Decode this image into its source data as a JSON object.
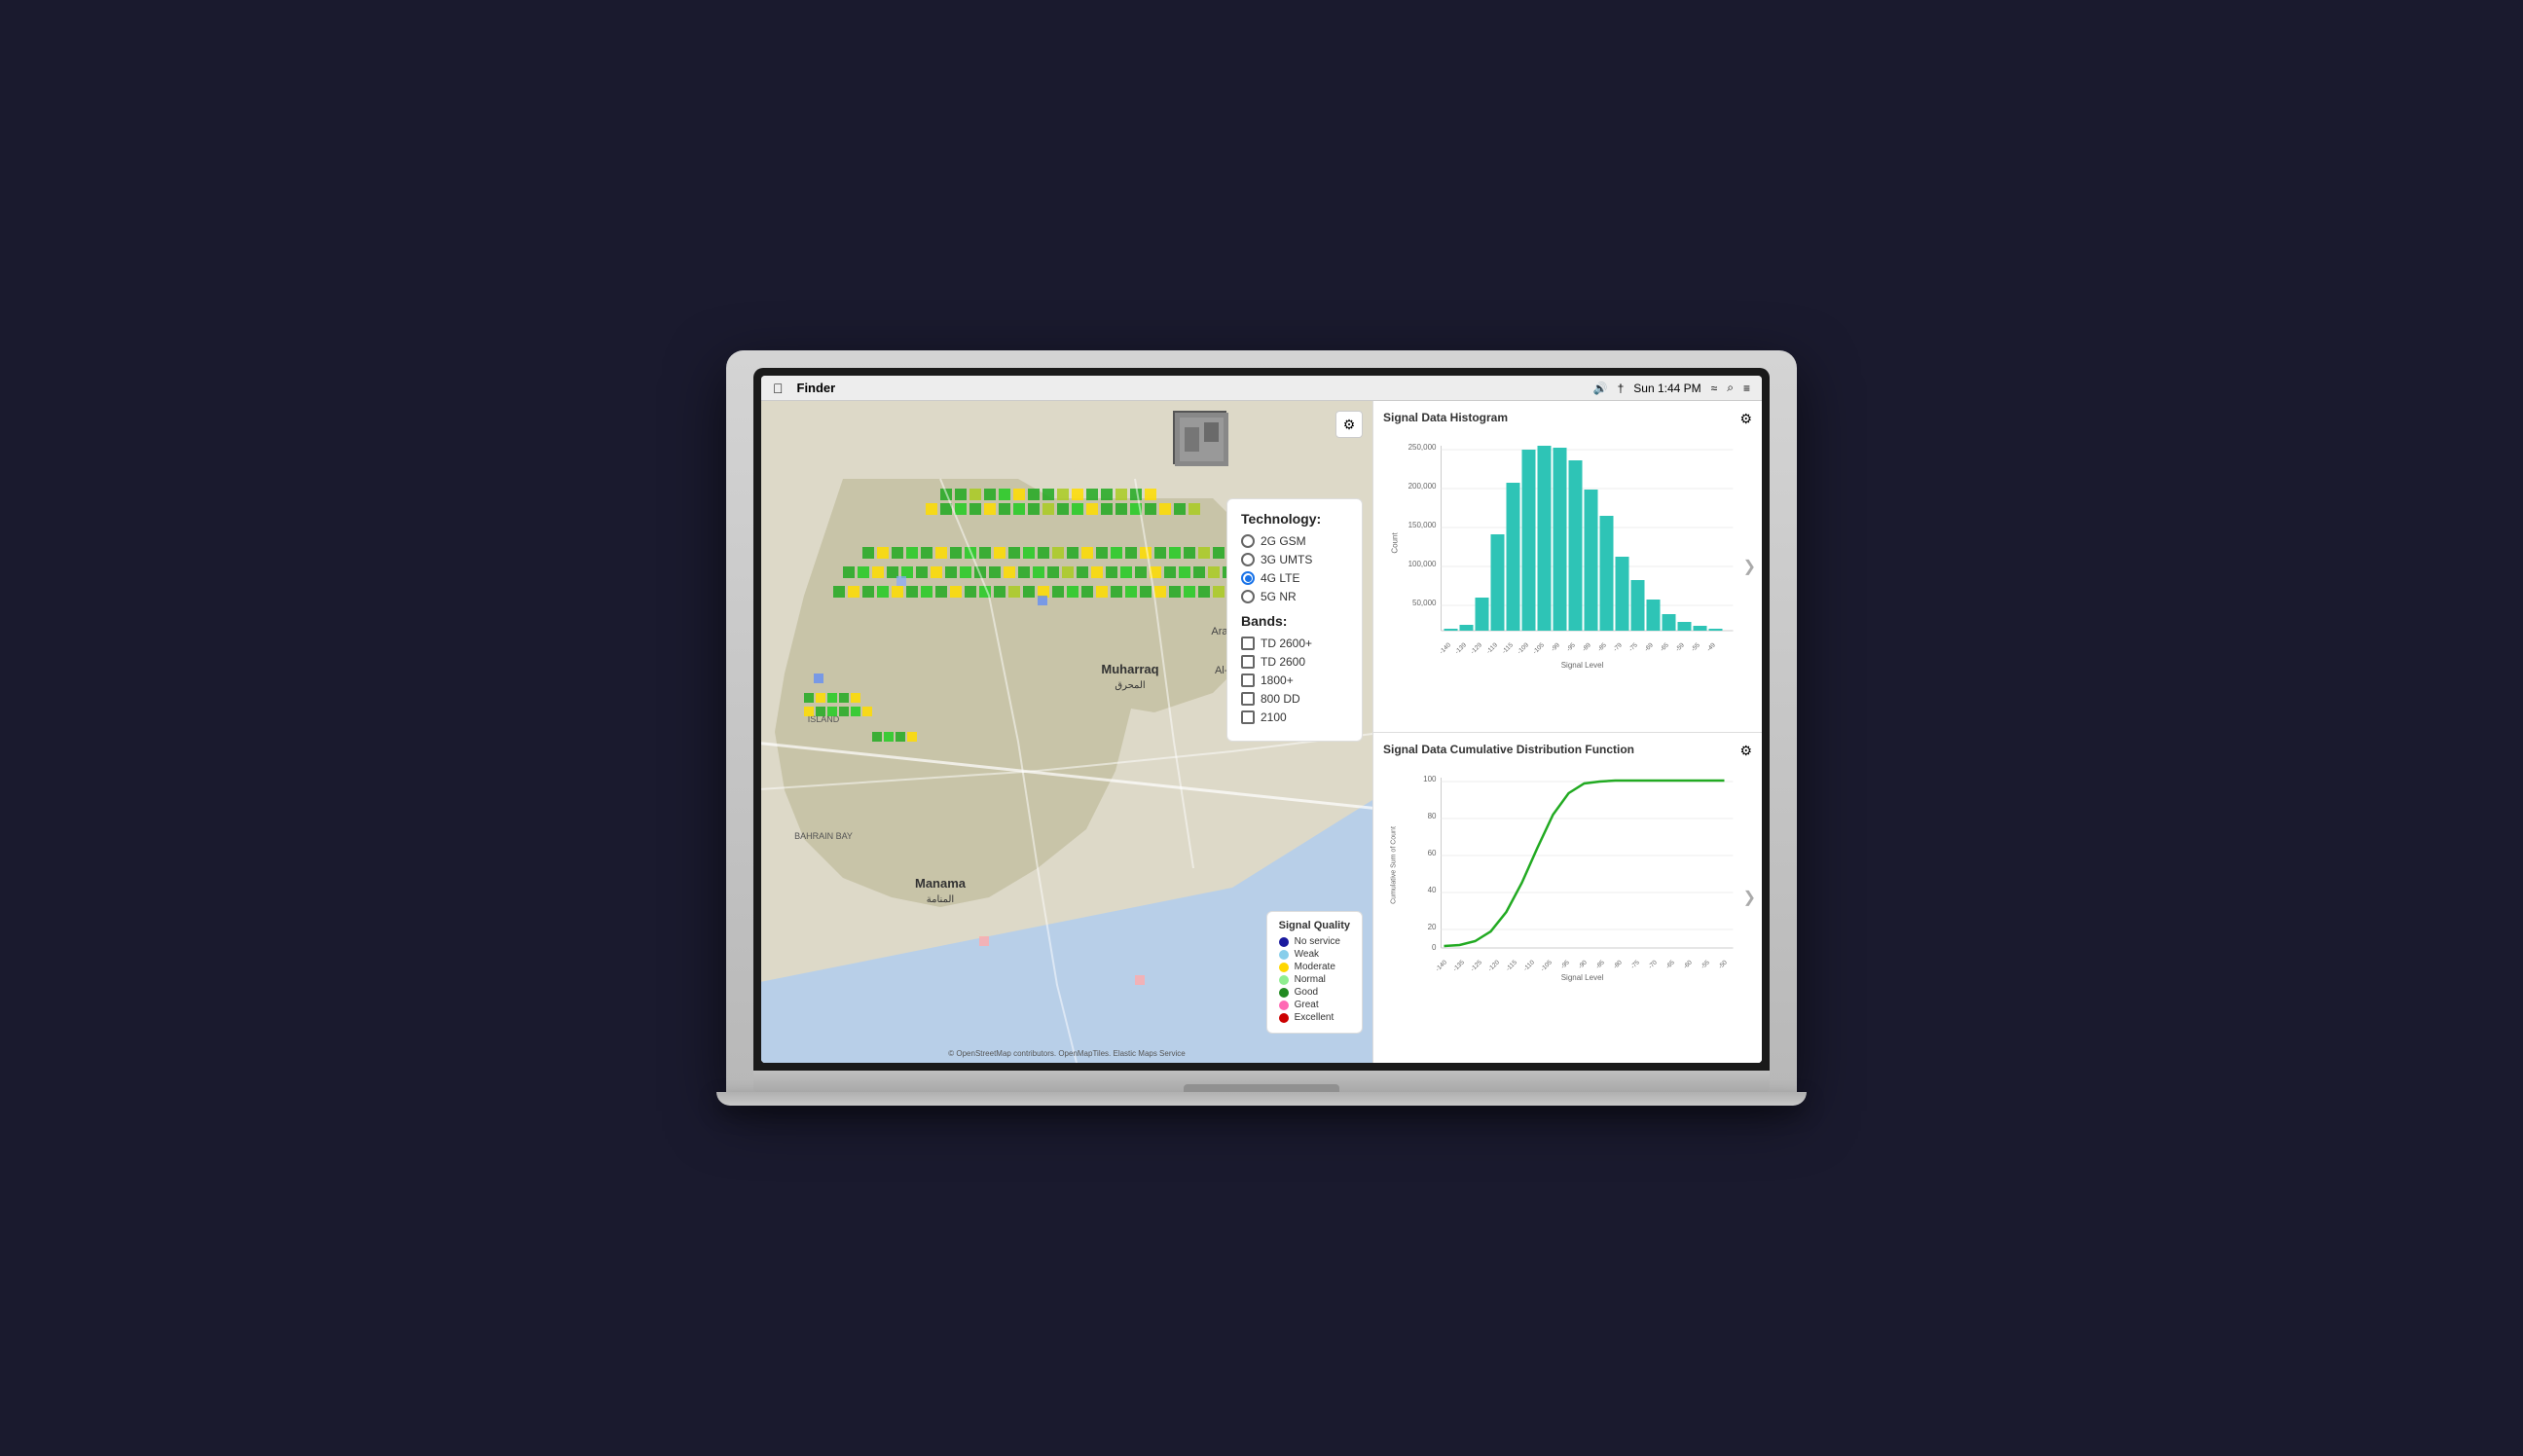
{
  "menu_bar": {
    "app_name": "Finder",
    "time": "Sun 1:44 PM"
  },
  "map": {
    "attribution": "© OpenStreetMap contributors. OpenMapTiles. Elastic Maps Service",
    "settings_icon": "⚙",
    "technology_label": "Technology:",
    "technologies": [
      {
        "label": "2G GSM",
        "selected": false
      },
      {
        "label": "3G UMTS",
        "selected": false
      },
      {
        "label": "4G LTE",
        "selected": true
      },
      {
        "label": "5G NR",
        "selected": false
      }
    ],
    "bands_label": "Bands:",
    "bands": [
      {
        "label": "TD 2600+",
        "checked": false
      },
      {
        "label": "TD 2600",
        "checked": false
      },
      {
        "label": "1800+",
        "checked": false
      },
      {
        "label": "800 DD",
        "checked": false
      },
      {
        "label": "2100",
        "checked": false
      }
    ],
    "signal_quality": {
      "title": "Signal Quality",
      "items": [
        {
          "label": "No service",
          "color": "#1a1a9e"
        },
        {
          "label": "Weak",
          "color": "#87ceeb"
        },
        {
          "label": "Moderate",
          "color": "#ffd700"
        },
        {
          "label": "Normal",
          "color": "#90ee90"
        },
        {
          "label": "Good",
          "color": "#228b22"
        },
        {
          "label": "Great",
          "color": "#ff69b4"
        },
        {
          "label": "Excellent",
          "color": "#cc0000"
        }
      ]
    }
  },
  "histogram": {
    "title": "Signal Data Histogram",
    "y_label": "Count",
    "x_label": "Signal Level",
    "y_max": 250000,
    "y_ticks": [
      "250,000",
      "200,000",
      "150,000",
      "100,000",
      "50,000"
    ],
    "x_ticks": [
      "-140",
      "-139",
      "-129",
      "-119",
      "-115",
      "-109",
      "-105",
      "-99",
      "-95",
      "-89",
      "-85",
      "-79",
      "-75",
      "-69",
      "-65",
      "-59",
      "-55",
      "-49"
    ],
    "bars": [
      {
        "x": -140,
        "count": 2000
      },
      {
        "x": -139,
        "count": 8000
      },
      {
        "x": -129,
        "count": 45000
      },
      {
        "x": -119,
        "count": 130000
      },
      {
        "x": -115,
        "count": 200000
      },
      {
        "x": -109,
        "count": 245000
      },
      {
        "x": -105,
        "count": 250000
      },
      {
        "x": -99,
        "count": 248000
      },
      {
        "x": -95,
        "count": 230000
      },
      {
        "x": -89,
        "count": 190000
      },
      {
        "x": -85,
        "count": 155000
      },
      {
        "x": -79,
        "count": 100000
      },
      {
        "x": -75,
        "count": 68000
      },
      {
        "x": -69,
        "count": 42000
      },
      {
        "x": -65,
        "count": 22000
      },
      {
        "x": -59,
        "count": 12000
      },
      {
        "x": -55,
        "count": 6000
      },
      {
        "x": -49,
        "count": 2000
      }
    ]
  },
  "cdf": {
    "title": "Signal Data Cumulative Distribution Function",
    "y_label": "Cumulative Sum of Count",
    "x_label": "Signal Level",
    "y_ticks": [
      "100",
      "80",
      "60",
      "40",
      "20",
      "0"
    ],
    "x_ticks": [
      "-140",
      "-135",
      "-125",
      "-120",
      "-115",
      "-110",
      "-105",
      "-95",
      "-90",
      "-85",
      "-80",
      "-75",
      "-70",
      "-65",
      "-60",
      "-55",
      "-50"
    ]
  },
  "icons": {
    "gear": "⚙",
    "chevron_right": "❯",
    "wifi": "WiFi",
    "bluetooth": "BT"
  }
}
